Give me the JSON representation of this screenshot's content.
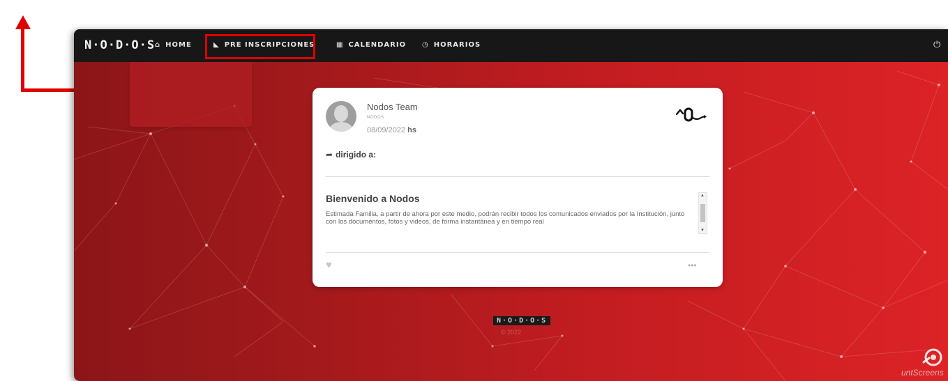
{
  "navbar": {
    "brand": "N·O·D·O·S",
    "items": [
      {
        "icon": "home-icon",
        "glyph": "⌂",
        "label": "HOME"
      },
      {
        "icon": "graduation-cap-icon",
        "glyph": "◣",
        "label": "PRE INSCRIPCIONES"
      },
      {
        "icon": "calendar-icon",
        "glyph": "▦",
        "label": "CALENDARIO"
      },
      {
        "icon": "clock-icon",
        "glyph": "◷",
        "label": "HORARIOS"
      }
    ],
    "power_glyph": "⏻"
  },
  "post": {
    "author": "Nodos Team",
    "author_sub": "NODOS",
    "date": "08/09/2022",
    "date_suffix": "hs",
    "share_glyph": "➦",
    "dirigido_label": "dirigido a:",
    "title": "Bienvenido a Nodos",
    "body": "Estimada Familia, a partir de ahora por este medio, podrán recibir todos los comunicados enviados por la Institución, junto con los documentos, fotos y videos, de forma instantánea y en tiempo real",
    "like_glyph": "♥",
    "more_glyph": "•••"
  },
  "footer": {
    "logo": "N·O·D·O·S",
    "year": "© 2022"
  },
  "watermark": {
    "text": "untScreens"
  },
  "colors": {
    "annotation": "#e00000",
    "navbar_bg": "#171717",
    "background_start": "#8c1518",
    "background_end": "#dc2326"
  }
}
